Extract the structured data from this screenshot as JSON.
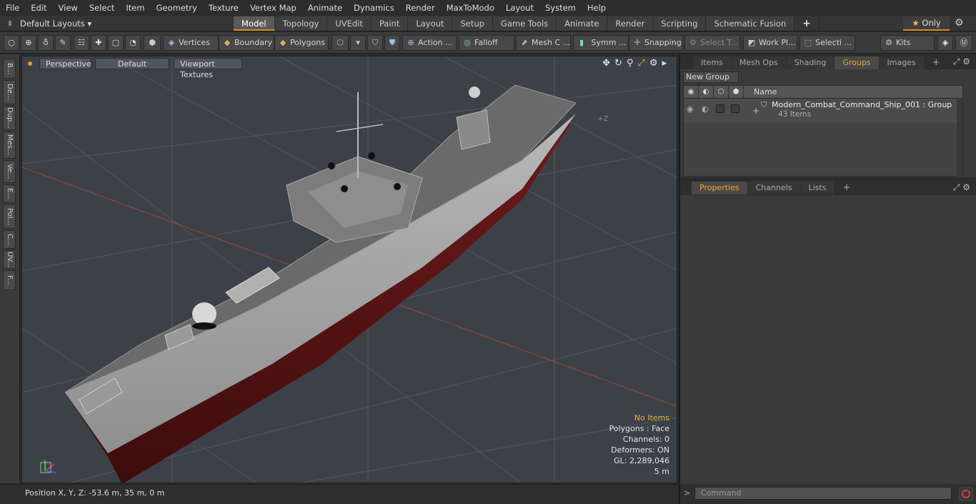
{
  "menu": [
    "File",
    "Edit",
    "View",
    "Select",
    "Item",
    "Geometry",
    "Texture",
    "Vertex Map",
    "Animate",
    "Dynamics",
    "Render",
    "MaxToModo",
    "Layout",
    "System",
    "Help"
  ],
  "layout": {
    "preset": "Default Layouts",
    "tabs": [
      "Model",
      "Topology",
      "UVEdit",
      "Paint",
      "Layout",
      "Setup",
      "Game Tools",
      "Animate",
      "Render",
      "Scripting",
      "Schematic Fusion"
    ],
    "only": "Only"
  },
  "toolbar": {
    "vertices": "Vertices",
    "boundary": "Boundary",
    "polygons": "Polygons",
    "action": "Action ...",
    "falloff": "Falloff",
    "meshc": "Mesh C ...",
    "symm": "Symm ...",
    "snapping": "Snapping",
    "selectt": "Select T...",
    "workpl": "Work Pl...",
    "selecti": "Selecti ...",
    "kits": "Kits"
  },
  "lefttabs": [
    "B...",
    "De...",
    "Dup...",
    "Mes...",
    "Ve...",
    "E...",
    "Pol...",
    "C...",
    "UV...",
    "F..."
  ],
  "viewport": {
    "view": "Perspective",
    "shading": "Default",
    "textures": "Viewport Textures",
    "axis_z_label": "+Z"
  },
  "info": {
    "items": "No Items",
    "polygons": "Polygons : Face",
    "channels": "Channels: 0",
    "deformers": "Deformers: ON",
    "gl": "GL: 2,289,046",
    "scale": "5 m"
  },
  "status": "Position X, Y, Z:   -53.6 m, 35 m, 0 m",
  "panel": {
    "tabs": [
      "Items",
      "Mesh Ops",
      "Shading",
      "Groups",
      "Images"
    ],
    "new_group": "New Group",
    "name_header": "Name",
    "group_name": "Modern_Combat_Command_Ship_001 : Group",
    "group_count": "43 Items"
  },
  "props": {
    "tabs": [
      "Properties",
      "Channels",
      "Lists"
    ]
  },
  "command": {
    "placeholder": "Command"
  }
}
